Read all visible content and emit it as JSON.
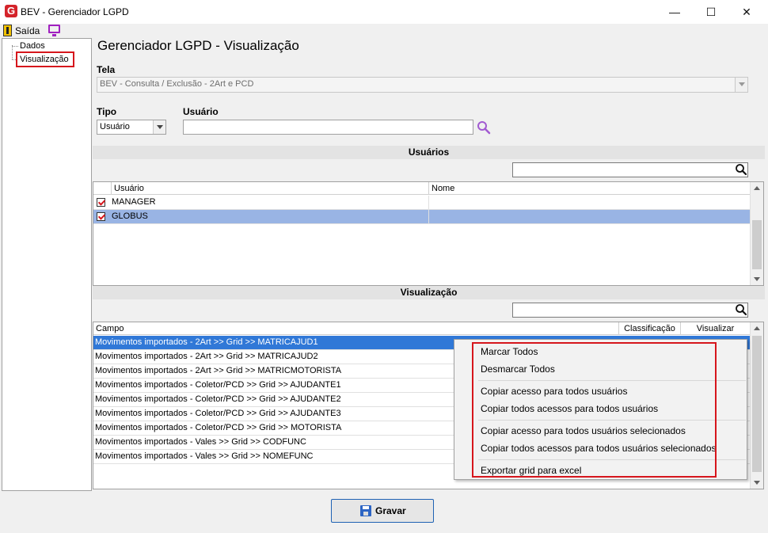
{
  "window": {
    "logo_letter": "G",
    "title": "BEV - Gerenciador LGPD",
    "minimize": "—",
    "maximize": "☐",
    "close": "✕"
  },
  "menu": {
    "exit_label": "Saída"
  },
  "tree": {
    "items": [
      "Dados",
      "Visualização"
    ]
  },
  "page": {
    "title": "Gerenciador LGPD - Visualização"
  },
  "tela": {
    "label": "Tela",
    "value": "BEV - Consulta / Exclusão - 2Art e PCD"
  },
  "tipo": {
    "label": "Tipo",
    "value": "Usuário"
  },
  "usuario_filter": {
    "label": "Usuário",
    "value": ""
  },
  "users_section": {
    "title": "Usuários",
    "columns": [
      "Usuário",
      "Nome"
    ],
    "rows": [
      {
        "usuario": "MANAGER",
        "nome": "",
        "checked": true,
        "selected": false
      },
      {
        "usuario": "GLOBUS",
        "nome": "",
        "checked": true,
        "selected": true
      }
    ]
  },
  "vis_section": {
    "title": "Visualização",
    "columns": [
      "Campo",
      "Classificação",
      "Visualizar"
    ],
    "rows": [
      "Movimentos importados - 2Art >> Grid >> MATRICAJUD1",
      "Movimentos importados - 2Art >> Grid >> MATRICAJUD2",
      "Movimentos importados - 2Art >> Grid >> MATRICMOTORISTA",
      "Movimentos importados - Coletor/PCD >> Grid >> AJUDANTE1",
      "Movimentos importados - Coletor/PCD >> Grid >> AJUDANTE2",
      "Movimentos importados - Coletor/PCD >> Grid >> AJUDANTE3",
      "Movimentos importados - Coletor/PCD >> Grid >> MOTORISTA",
      "Movimentos importados - Vales >> Grid >> CODFUNC",
      "Movimentos importados - Vales >> Grid >> NOMEFUNC"
    ]
  },
  "context_menu": {
    "items": [
      "Marcar Todos",
      "Desmarcar Todos",
      "Copiar acesso para todos usuários",
      "Copiar todos acessos para todos usuários",
      "Copiar acesso para todos usuários selecionados",
      "Copiar todos acessos para todos usuários selecionados",
      "Exportar grid para excel"
    ]
  },
  "save_button": {
    "label": "Gravar"
  },
  "colors": {
    "selection": "#3078d7",
    "user_selected": "#99b4e4",
    "highlight": "#d6161c"
  }
}
